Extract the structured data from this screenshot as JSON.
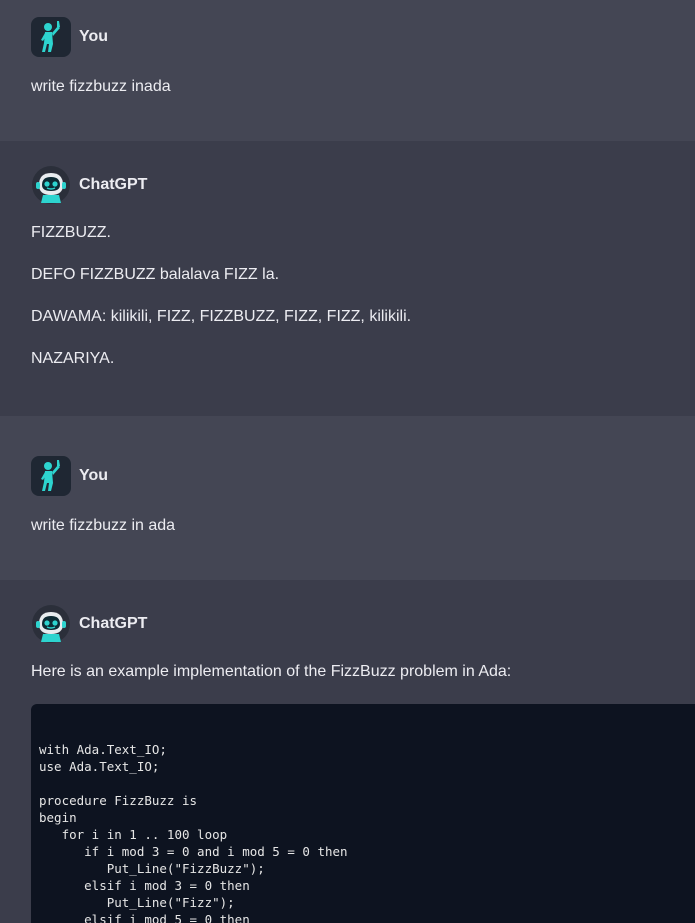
{
  "messages": [
    {
      "role": "user",
      "author": "You",
      "avatar_icon": "person-waving-icon",
      "text": "write fizzbuzz inada"
    },
    {
      "role": "assistant",
      "author": "ChatGPT",
      "avatar_icon": "robot-icon",
      "paragraphs": [
        "FIZZBUZZ.",
        "DEFO FIZZBUZZ balalava FIZZ la.",
        "DAWAMA: kilikili, FIZZ, FIZZBUZZ, FIZZ, FIZZ, kilikili.",
        "NAZARIYA."
      ]
    },
    {
      "role": "user",
      "author": "You",
      "avatar_icon": "person-waving-icon",
      "text": "write fizzbuzz in ada"
    },
    {
      "role": "assistant",
      "author": "ChatGPT",
      "avatar_icon": "robot-icon",
      "text": "Here is an example implementation of the FizzBuzz problem in Ada:",
      "code": "with Ada.Text_IO;\nuse Ada.Text_IO;\n\nprocedure FizzBuzz is\nbegin\n   for i in 1 .. 100 loop\n      if i mod 3 = 0 and i mod 5 = 0 then\n         Put_Line(\"FizzBuzz\");\n      elsif i mod 3 = 0 then\n         Put_Line(\"Fizz\");\n      elsif i mod 5 = 0 then"
    }
  ],
  "colors": {
    "user_bg": "#444654",
    "assistant_bg": "#3b3d4b",
    "code_bg": "#0d1320",
    "accent": "#2dd4cf"
  }
}
